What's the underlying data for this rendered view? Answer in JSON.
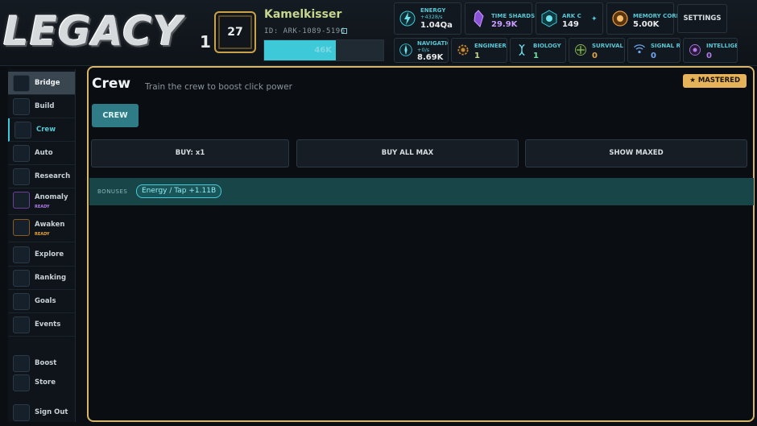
{
  "header": {
    "logo_text": "LEGACY",
    "logo_suffix": "1",
    "level": "27",
    "player_name": "Kamelkisser",
    "player_id": "ID: ARK-1089-5196",
    "xp_text": "46K",
    "xp_progress": 0.6,
    "settings_label": "SETTINGS"
  },
  "resources": {
    "energy": {
      "label": "ENERGY",
      "rate": "+4328/s",
      "value": "1.04Qa"
    },
    "time_shards": {
      "label": "TIME SHARDS",
      "value": "29.9K"
    },
    "ark_core": {
      "label": "ARK COI",
      "value": "149"
    },
    "memory_core": {
      "label": "MEMORY CORE",
      "value": "5.00K"
    },
    "navigation": {
      "label": "NAVIGATIO",
      "rate": "+0/s",
      "value": "8.69K"
    },
    "engineering": {
      "label": "ENGINEERII",
      "value": "1"
    },
    "biology": {
      "label": "BIOLOGY",
      "value": "1"
    },
    "survival": {
      "label": "SURVIVAL",
      "value": "0"
    },
    "signal": {
      "label": "SIGNAL REI",
      "value": "0"
    },
    "intelligence": {
      "label": "INTELLIGEI",
      "value": "0"
    }
  },
  "sidebar": {
    "items": [
      {
        "label": "Bridge"
      },
      {
        "label": "Build"
      },
      {
        "label": "Crew"
      },
      {
        "label": "Auto"
      },
      {
        "label": "Research"
      },
      {
        "label": "Anomaly",
        "badge": "READY"
      },
      {
        "label": "Awaken",
        "badge": "READY"
      },
      {
        "label": "Explore"
      },
      {
        "label": "Ranking"
      },
      {
        "label": "Goals"
      },
      {
        "label": "Events"
      },
      {
        "label": "Boost"
      },
      {
        "label": "Store"
      },
      {
        "label": "Sign Out"
      }
    ]
  },
  "main": {
    "title": "Crew",
    "description": "Train the crew to boost click power",
    "mastered_label": "★ MASTERED",
    "crew_button": "CREW",
    "buy_button": "BUY: x1",
    "buy_all_button": "BUY ALL MAX",
    "show_maxed_button": "SHOW MAXED",
    "bonuses_label": "BONUSES",
    "bonus_chip": "Energy / Tap +1.11B"
  },
  "colors": {
    "accent": "#3ec9d9",
    "gold": "#d9b56a",
    "mastered": "#e7b35a",
    "ready_purple": "#b07ce8",
    "ready_orange": "#e7a63a"
  }
}
